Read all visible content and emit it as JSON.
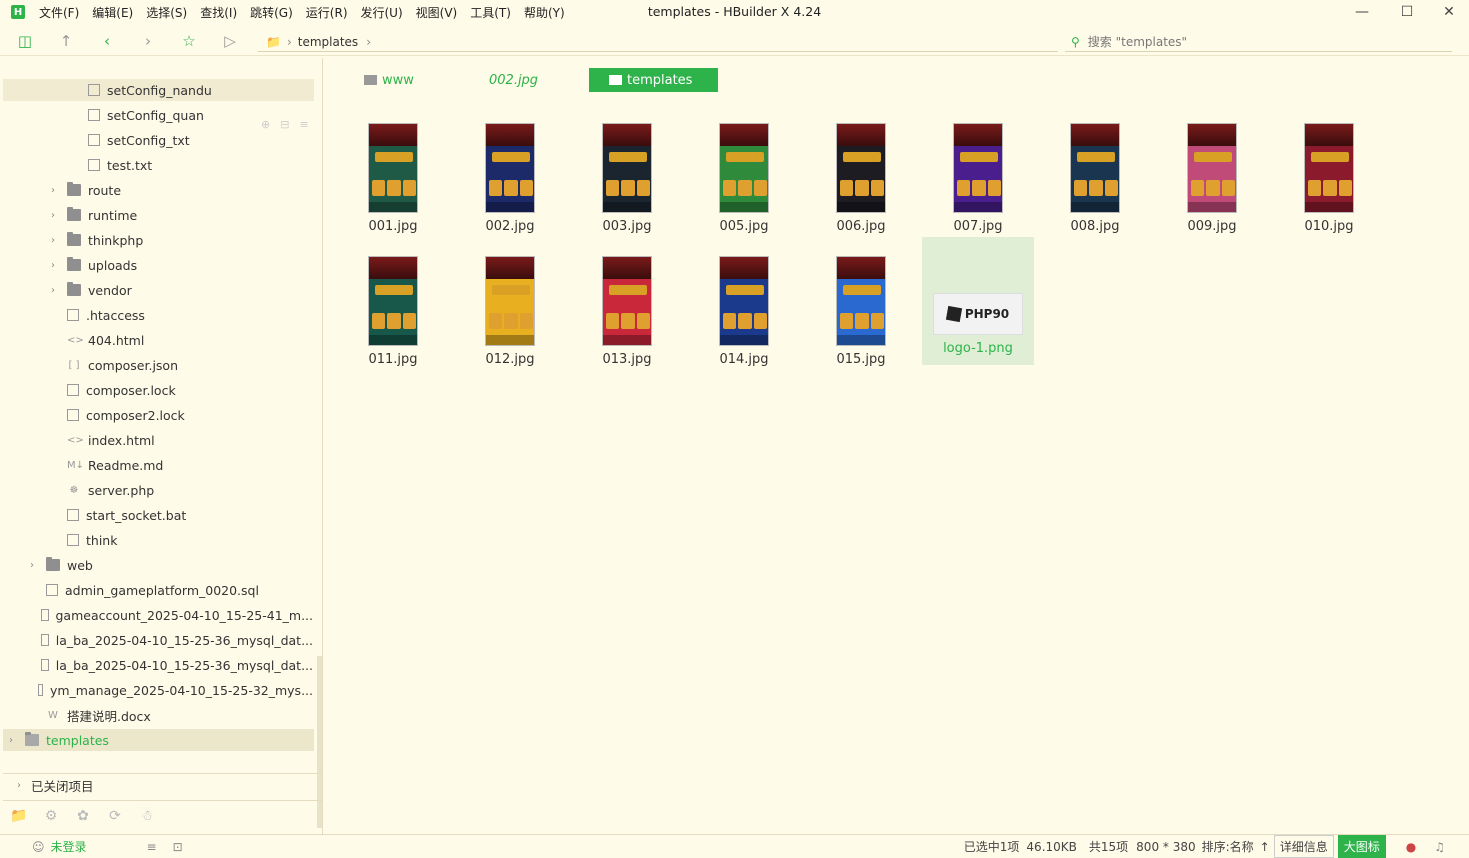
{
  "window": {
    "title": "templates - HBuilder X 4.24",
    "logo_letter": "H",
    "menu": [
      "文件(F)",
      "编辑(E)",
      "选择(S)",
      "查找(I)",
      "跳转(G)",
      "运行(R)",
      "发行(U)",
      "视图(V)",
      "工具(T)",
      "帮助(Y)"
    ]
  },
  "toolbar": {
    "path": "templates",
    "search_placeholder": "搜索 \"templates\""
  },
  "sidebar": {
    "items": [
      {
        "label": "setConfig_nandu",
        "icon": "file-icon"
      },
      {
        "label": "setConfig_quan",
        "icon": "file-icon"
      },
      {
        "label": "setConfig_txt",
        "icon": "file-icon"
      },
      {
        "label": "test.txt",
        "icon": "file-icon"
      },
      {
        "label": "route",
        "icon": "folder-icon"
      },
      {
        "label": "runtime",
        "icon": "folder-icon"
      },
      {
        "label": "thinkphp",
        "icon": "folder-icon"
      },
      {
        "label": "uploads",
        "icon": "folder-icon"
      },
      {
        "label": "vendor",
        "icon": "folder-icon"
      },
      {
        "label": ".htaccess",
        "icon": "file-icon"
      },
      {
        "label": "404.html",
        "icon": "html-icon"
      },
      {
        "label": "composer.json",
        "icon": "json-icon"
      },
      {
        "label": "composer.lock",
        "icon": "file-icon"
      },
      {
        "label": "composer2.lock",
        "icon": "file-icon"
      },
      {
        "label": "index.html",
        "icon": "html-icon"
      },
      {
        "label": "Readme.md",
        "icon": "markdown-icon"
      },
      {
        "label": "server.php",
        "icon": "php-icon"
      },
      {
        "label": "start_socket.bat",
        "icon": "file-icon"
      },
      {
        "label": "think",
        "icon": "file-icon"
      },
      {
        "label": "web",
        "icon": "folder-icon"
      },
      {
        "label": "admin_gameplatform_0020.sql",
        "icon": "file-icon"
      },
      {
        "label": "gameaccount_2025-04-10_15-25-41_m...",
        "icon": "file-icon"
      },
      {
        "label": "la_ba_2025-04-10_15-25-36_mysql_dat...",
        "icon": "file-icon"
      },
      {
        "label": "la_ba_2025-04-10_15-25-36_mysql_dat...",
        "icon": "file-icon"
      },
      {
        "label": "ym_manage_2025-04-10_15-25-32_mys...",
        "icon": "file-icon"
      },
      {
        "label": "搭建说明.docx",
        "icon": "word-icon"
      },
      {
        "label": "templates",
        "icon": "folder-icon"
      }
    ],
    "closed_projects": "已关闭项目"
  },
  "main": {
    "tabs": [
      {
        "label": "www"
      },
      {
        "label": "002.jpg"
      },
      {
        "label": "templates"
      }
    ],
    "files": [
      {
        "name": "001.jpg",
        "color": "#1f5a46"
      },
      {
        "name": "002.jpg",
        "color": "#1d2a6a"
      },
      {
        "name": "003.jpg",
        "color": "#1a2530"
      },
      {
        "name": "005.jpg",
        "color": "#2f8a3c"
      },
      {
        "name": "006.jpg",
        "color": "#1c1c22"
      },
      {
        "name": "007.jpg",
        "color": "#4a1e8c"
      },
      {
        "name": "008.jpg",
        "color": "#1a3550"
      },
      {
        "name": "009.jpg",
        "color": "#c04a78"
      },
      {
        "name": "010.jpg",
        "color": "#8a1a2c"
      },
      {
        "name": "011.jpg",
        "color": "#17584a"
      },
      {
        "name": "012.jpg",
        "color": "#e8b020"
      },
      {
        "name": "013.jpg",
        "color": "#c8283a"
      },
      {
        "name": "014.jpg",
        "color": "#1c3a8c"
      },
      {
        "name": "015.jpg",
        "color": "#2a6ad0"
      }
    ],
    "logo_file": {
      "name": "logo-1.png",
      "text": "PHP90"
    }
  },
  "status": {
    "login": "未登录",
    "selected": "已选中1项",
    "size": "46.10KB",
    "count": "共15项",
    "dimensions": "800 * 380",
    "sort": "排序:名称",
    "detail_btn": "详细信息",
    "large_btn": "大图标"
  },
  "colors": {
    "accent": "#2db34a",
    "bg": "#fffbe9"
  }
}
